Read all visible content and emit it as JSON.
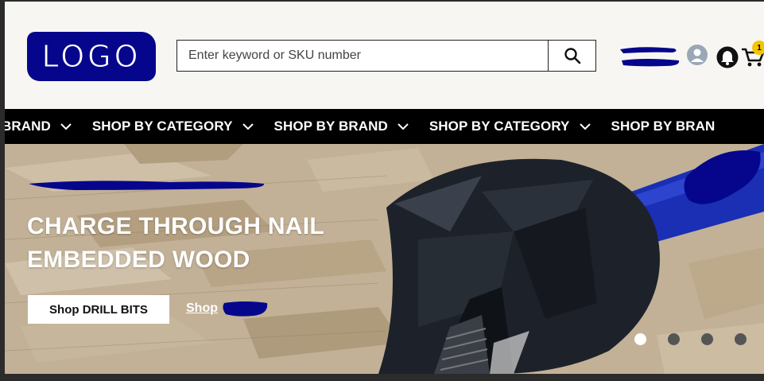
{
  "header": {
    "logo_text": "LOGO",
    "search": {
      "placeholder": "Enter keyword or SKU number",
      "value": ""
    },
    "search_button_icon": "search-icon",
    "account_icon": "user-icon",
    "notifications_icon": "bell-icon",
    "cart_icon": "cart-icon",
    "cart_count": "1"
  },
  "nav": {
    "items": [
      {
        "label": "Y BRAND"
      },
      {
        "label": "SHOP BY CATEGORY"
      },
      {
        "label": "SHOP BY BRAND"
      },
      {
        "label": "SHOP BY CATEGORY"
      },
      {
        "label": "SHOP BY BRAN"
      }
    ]
  },
  "hero": {
    "headline_line1": "CHARGE THROUGH NAIL",
    "headline_line2": "EMBEDDED WOOD",
    "primary_cta": "Shop DRILL BITS",
    "secondary_cta": "Shop",
    "slide_count": 4,
    "active_slide": 1
  },
  "colors": {
    "redaction": "#06068c",
    "nav_bg": "#000000",
    "badge": "#f5c400",
    "bit_blue": "#1a2fb4"
  }
}
